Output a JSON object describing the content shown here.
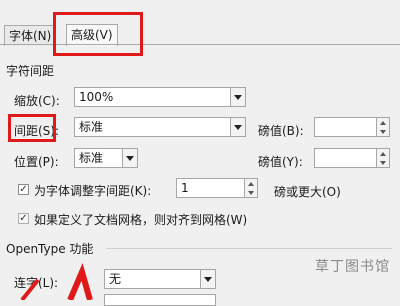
{
  "tabs": [
    {
      "label": "字体(N)"
    },
    {
      "label": "高级(V)"
    }
  ],
  "section": {
    "char_spacing": "字符间距",
    "opentype": "OpenType 功能"
  },
  "scale": {
    "label": "缩放(C):",
    "value": "100%"
  },
  "spacing": {
    "label": "间距(S):",
    "value": "标准",
    "by_label": "磅值(B):",
    "by_value": ""
  },
  "position": {
    "label": "位置(P):",
    "value": "标准",
    "by_label": "磅值(Y):",
    "by_value": ""
  },
  "kerning": {
    "label": "为字体调整字间距(K):",
    "value": "1",
    "suffix": "磅或更大(O)"
  },
  "grid": {
    "label": "如果定义了文档网格，则对齐到网格(W)"
  },
  "ligatures": {
    "label": "连字(L):",
    "value": "无"
  },
  "watermark": "草丁图书馆",
  "colors": {
    "highlight": "#e01a1a"
  }
}
